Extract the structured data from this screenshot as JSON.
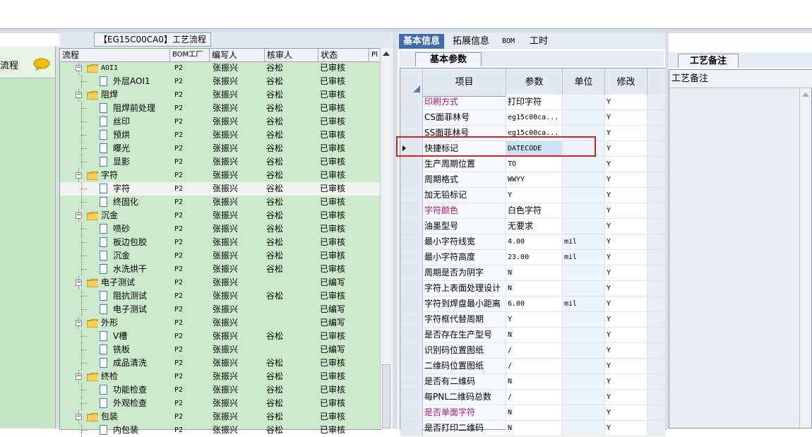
{
  "left_strip": {
    "label": "流程"
  },
  "tree": {
    "title": "【EG15C00CA0】工艺流程",
    "columns": [
      "流程",
      "BOM工厂",
      "编写人",
      "核审人",
      "状态",
      "Pl"
    ],
    "rows": [
      {
        "level": 0,
        "type": "folder",
        "name": "AOI1",
        "bom": "P2",
        "writer": "张振兴",
        "reviewer": "谷松",
        "status": "已审核"
      },
      {
        "level": 1,
        "type": "doc",
        "name": "外层AOI1",
        "bom": "P2",
        "writer": "张振兴",
        "reviewer": "谷松",
        "status": "已审核"
      },
      {
        "level": 0,
        "type": "folder",
        "name": "阻焊",
        "bom": "P2",
        "writer": "张振兴",
        "reviewer": "谷松",
        "status": "已审核"
      },
      {
        "level": 1,
        "type": "doc",
        "name": "阻焊前处理",
        "bom": "P2",
        "writer": "张振兴",
        "reviewer": "谷松",
        "status": "已审核"
      },
      {
        "level": 1,
        "type": "doc",
        "name": "丝印",
        "bom": "P2",
        "writer": "张振兴",
        "reviewer": "谷松",
        "status": "已审核"
      },
      {
        "level": 1,
        "type": "doc",
        "name": "预烘",
        "bom": "P2",
        "writer": "张振兴",
        "reviewer": "谷松",
        "status": "已审核"
      },
      {
        "level": 1,
        "type": "doc",
        "name": "曝光",
        "bom": "P2",
        "writer": "张振兴",
        "reviewer": "谷松",
        "status": "已审核"
      },
      {
        "level": 1,
        "type": "doc",
        "name": "显影",
        "bom": "P2",
        "writer": "张振兴",
        "reviewer": "谷松",
        "status": "已审核"
      },
      {
        "level": 0,
        "type": "folder",
        "name": "字符",
        "bom": "P2",
        "writer": "张振兴",
        "reviewer": "谷松",
        "status": "已审核"
      },
      {
        "level": 1,
        "type": "doc",
        "name": "字符",
        "bom": "P2",
        "writer": "张振兴",
        "reviewer": "谷松",
        "status": "已审核",
        "selected": true
      },
      {
        "level": 1,
        "type": "doc",
        "name": "终固化",
        "bom": "P2",
        "writer": "张振兴",
        "reviewer": "谷松",
        "status": "已审核"
      },
      {
        "level": 0,
        "type": "folder",
        "name": "沉金",
        "bom": "P2",
        "writer": "张振兴",
        "reviewer": "谷松",
        "status": "已审核"
      },
      {
        "level": 1,
        "type": "doc",
        "name": "喷砂",
        "bom": "P2",
        "writer": "张振兴",
        "reviewer": "谷松",
        "status": "已审核"
      },
      {
        "level": 1,
        "type": "doc",
        "name": "板边包胶",
        "bom": "P2",
        "writer": "张振兴",
        "reviewer": "谷松",
        "status": "已审核"
      },
      {
        "level": 1,
        "type": "doc",
        "name": "沉金",
        "bom": "P2",
        "writer": "张振兴",
        "reviewer": "谷松",
        "status": "已审核"
      },
      {
        "level": 1,
        "type": "doc",
        "name": "水洗烘干",
        "bom": "P2",
        "writer": "张振兴",
        "reviewer": "谷松",
        "status": "已审核"
      },
      {
        "level": 0,
        "type": "folder",
        "name": "电子测试",
        "bom": "P2",
        "writer": "张振兴",
        "reviewer": "",
        "status": "已编写"
      },
      {
        "level": 1,
        "type": "doc",
        "name": "阻抗测试",
        "bom": "P2",
        "writer": "张振兴",
        "reviewer": "谷松",
        "status": "已审核"
      },
      {
        "level": 1,
        "type": "doc",
        "name": "电子测试",
        "bom": "P2",
        "writer": "张振兴",
        "reviewer": "",
        "status": "已编写"
      },
      {
        "level": 0,
        "type": "folder",
        "name": "外形",
        "bom": "P2",
        "writer": "张振兴",
        "reviewer": "",
        "status": "已编写"
      },
      {
        "level": 1,
        "type": "doc",
        "name": "V槽",
        "bom": "P2",
        "writer": "张振兴",
        "reviewer": "谷松",
        "status": "已审核"
      },
      {
        "level": 1,
        "type": "doc",
        "name": "铣板",
        "bom": "P2",
        "writer": "张振兴",
        "reviewer": "",
        "status": "已编写"
      },
      {
        "level": 1,
        "type": "doc",
        "name": "成品清洗",
        "bom": "P2",
        "writer": "张振兴",
        "reviewer": "谷松",
        "status": "已审核"
      },
      {
        "level": 0,
        "type": "folder",
        "name": "终检",
        "bom": "P2",
        "writer": "张振兴",
        "reviewer": "谷松",
        "status": "已审核"
      },
      {
        "level": 1,
        "type": "doc",
        "name": "功能检查",
        "bom": "P2",
        "writer": "张振兴",
        "reviewer": "谷松",
        "status": "已审核"
      },
      {
        "level": 1,
        "type": "doc",
        "name": "外观检查",
        "bom": "P2",
        "writer": "张振兴",
        "reviewer": "谷松",
        "status": "已审核"
      },
      {
        "level": 0,
        "type": "folder",
        "name": "包装",
        "bom": "P2",
        "writer": "张振兴",
        "reviewer": "谷松",
        "status": "已审核"
      },
      {
        "level": 1,
        "type": "doc",
        "name": "内包装",
        "bom": "P2",
        "writer": "张振兴",
        "reviewer": "谷松",
        "status": "已审核"
      }
    ]
  },
  "right_tabs": [
    "基本信息",
    "拓展信息",
    "BOM",
    "工时"
  ],
  "subtab_label": "基本参数",
  "params_grid": {
    "columns": [
      "项目",
      "参数",
      "单位",
      "修改"
    ],
    "rows": [
      {
        "item": "印刷方式",
        "value": "打印字符",
        "unit": "",
        "mod": "Y",
        "highlight": true
      },
      {
        "item": "CS面菲林号",
        "value": "eg15c00ca...",
        "unit": "",
        "mod": "Y"
      },
      {
        "item": "SS面菲林号",
        "value": "eg15c00ca...",
        "unit": "",
        "mod": "Y"
      },
      {
        "item": "快捷标记",
        "value": "DATECODE",
        "unit": "",
        "mod": "Y",
        "selected": true
      },
      {
        "item": "生产周期位置",
        "value": "TO",
        "unit": "",
        "mod": "Y"
      },
      {
        "item": "周期格式",
        "value": "WWYY",
        "unit": "",
        "mod": "Y"
      },
      {
        "item": "加无铅标记",
        "value": "Y",
        "unit": "",
        "mod": "Y"
      },
      {
        "item": "字符颜色",
        "value": "白色字符",
        "unit": "",
        "mod": "Y",
        "highlight": true
      },
      {
        "item": "油墨型号",
        "value": "无要求",
        "unit": "",
        "mod": "Y"
      },
      {
        "item": "最小字符线宽",
        "value": "4.00",
        "unit": "mil",
        "mod": "Y"
      },
      {
        "item": "最小字符高度",
        "value": "23.00",
        "unit": "mil",
        "mod": "Y"
      },
      {
        "item": "周期是否为阴字",
        "value": "N",
        "unit": "",
        "mod": "Y"
      },
      {
        "item": "字符上表面处理设计",
        "value": "N",
        "unit": "",
        "mod": "Y"
      },
      {
        "item": "字符到焊盘最小距离",
        "value": "6.00",
        "unit": "mil",
        "mod": "Y"
      },
      {
        "item": "字符框代替周期",
        "value": "Y",
        "unit": "",
        "mod": "Y"
      },
      {
        "item": "是否存在生产型号",
        "value": "N",
        "unit": "",
        "mod": "Y"
      },
      {
        "item": "识别码位置图纸",
        "value": "/",
        "unit": "",
        "mod": "Y"
      },
      {
        "item": "二维码位置图纸",
        "value": "/",
        "unit": "",
        "mod": "Y"
      },
      {
        "item": "是否有二维码",
        "value": "N",
        "unit": "",
        "mod": "Y"
      },
      {
        "item": "每PNL二维码总数",
        "value": "/",
        "unit": "",
        "mod": "Y"
      },
      {
        "item": "是否单面字符",
        "value": "N",
        "unit": "",
        "mod": "Y",
        "highlight": true
      },
      {
        "item": "是否打印二维码",
        "value": "N",
        "unit": "",
        "mod": "Y"
      }
    ]
  },
  "remarks": {
    "tab": "工艺备注",
    "header": "工艺备注"
  },
  "colors": {
    "tree_bg": "#cce9cc",
    "tab_active": "#3f6ab0",
    "highlight_text": "#b0157a",
    "selection_box": "#d62020"
  }
}
